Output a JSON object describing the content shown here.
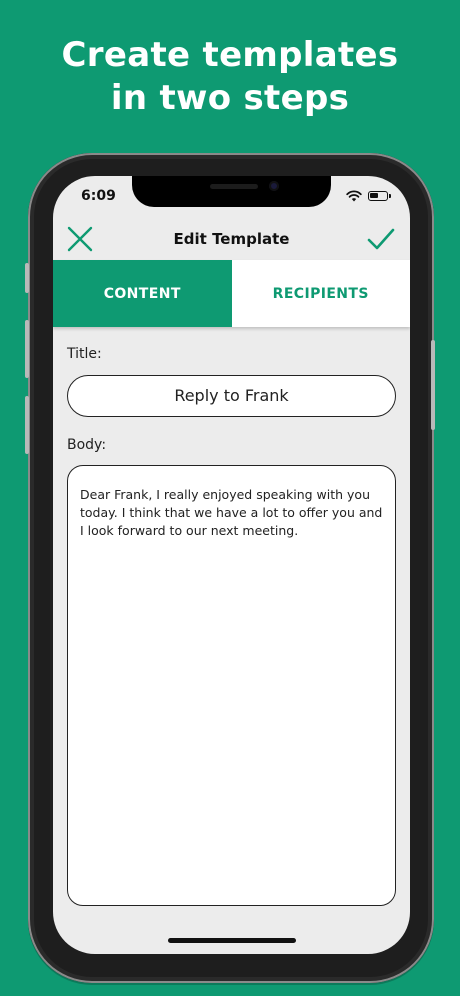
{
  "headline": {
    "line1": "Create templates",
    "line2": "in two steps"
  },
  "status_bar": {
    "time": "6:09"
  },
  "navbar": {
    "title": "Edit Template",
    "close_icon": "close-icon",
    "confirm_icon": "checkmark-icon"
  },
  "tabs": [
    {
      "label": "CONTENT",
      "active": true
    },
    {
      "label": "RECIPIENTS",
      "active": false
    }
  ],
  "form": {
    "title_label": "Title:",
    "title_value": "Reply to Frank",
    "body_label": "Body:",
    "body_value": "Dear Frank, I really enjoyed speaking with you today. I think that we have a lot to offer you and I look forward to our next meeting."
  },
  "colors": {
    "accent": "#0e9a72",
    "background": "#0e9a72",
    "screen": "#ececec"
  }
}
